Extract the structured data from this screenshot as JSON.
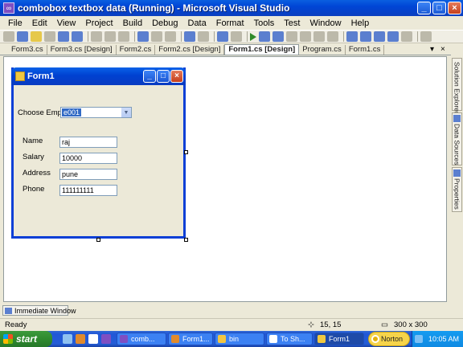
{
  "window": {
    "title": "combobox textbox data (Running) - Microsoft Visual Studio",
    "min_label": "_",
    "max_label": "□",
    "close_label": "×"
  },
  "menu": [
    "File",
    "Edit",
    "View",
    "Project",
    "Build",
    "Debug",
    "Data",
    "Format",
    "Tools",
    "Test",
    "Window",
    "Help"
  ],
  "doc_tabs": [
    {
      "label": "Form3.cs",
      "active": false
    },
    {
      "label": "Form3.cs [Design]",
      "active": false
    },
    {
      "label": "Form2.cs",
      "active": false
    },
    {
      "label": "Form2.cs [Design]",
      "active": false
    },
    {
      "label": "Form1.cs [Design]",
      "active": true
    },
    {
      "label": "Program.cs",
      "active": false
    },
    {
      "label": "Form1.cs",
      "active": false
    }
  ],
  "tab_controls": {
    "dropdown": "▾",
    "close": "×"
  },
  "form": {
    "title": "Form1",
    "min_label": "_",
    "max_label": "□",
    "close_label": "×",
    "choose_label": "Choose Empid",
    "combo_value": "e001",
    "combo_arrow": "▼",
    "fields": [
      {
        "label": "Name",
        "value": "raj"
      },
      {
        "label": "Salary",
        "value": "10000"
      },
      {
        "label": "Address",
        "value": "pune"
      },
      {
        "label": "Phone",
        "value": "111111111"
      }
    ]
  },
  "side_tabs": [
    "Solution Explorer",
    "Data Sources",
    "Properties"
  ],
  "bottom_tab": "Immediate Window",
  "status": {
    "ready": "Ready",
    "position": "15, 15",
    "size": "300 x 300"
  },
  "taskbar": {
    "start": "start",
    "tasks": [
      "comb...",
      "Form1...",
      "bin",
      "To Sh...",
      "Form1"
    ],
    "norton": "Norton",
    "clock": "10:05 AM"
  }
}
